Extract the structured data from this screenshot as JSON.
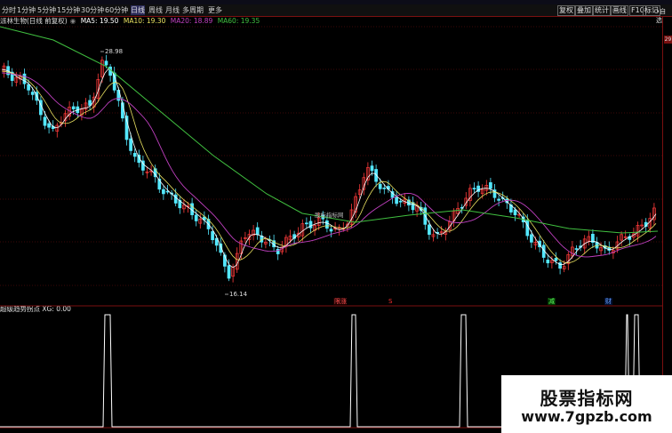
{
  "toolbar": {
    "timeframes": [
      "分时",
      "1分钟",
      "5分钟",
      "15分钟",
      "30分钟",
      "60分钟",
      "日线",
      "周线",
      "月线",
      "多周期",
      "更多"
    ],
    "active_index": 6,
    "right_buttons": [
      "复权",
      "叠加",
      "统计",
      "画线",
      "F10",
      "标记"
    ],
    "auto_label": "•自选"
  },
  "legend": {
    "stock_name": "派林生物(日线 前复权)",
    "ma5": "MA5: 19.50",
    "ma10": "MA10: 19.30",
    "ma20": "MA20: 18.89",
    "ma60": "MA60: 19.35",
    "colors": {
      "ma5": "#ffffff",
      "ma10": "#e8e060",
      "ma20": "#c040c0",
      "ma60": "#40c040"
    }
  },
  "indicator": {
    "name": "超级趋势拐点",
    "value": "XG: 0.00"
  },
  "annotations": {
    "high_label": "28.98",
    "low_label": "16.14",
    "chart_watermark": "股标指标网",
    "signal_labels": [
      "限涨",
      "S",
      "减",
      "财"
    ],
    "right_axis_label": "29"
  },
  "watermark": {
    "line1": "股票指标网",
    "line2": "www.7gpzb.com"
  },
  "colors": {
    "up": "#ff3b3b",
    "down": "#54e8ff",
    "grid": "#7a1010",
    "background": "#000000"
  }
}
